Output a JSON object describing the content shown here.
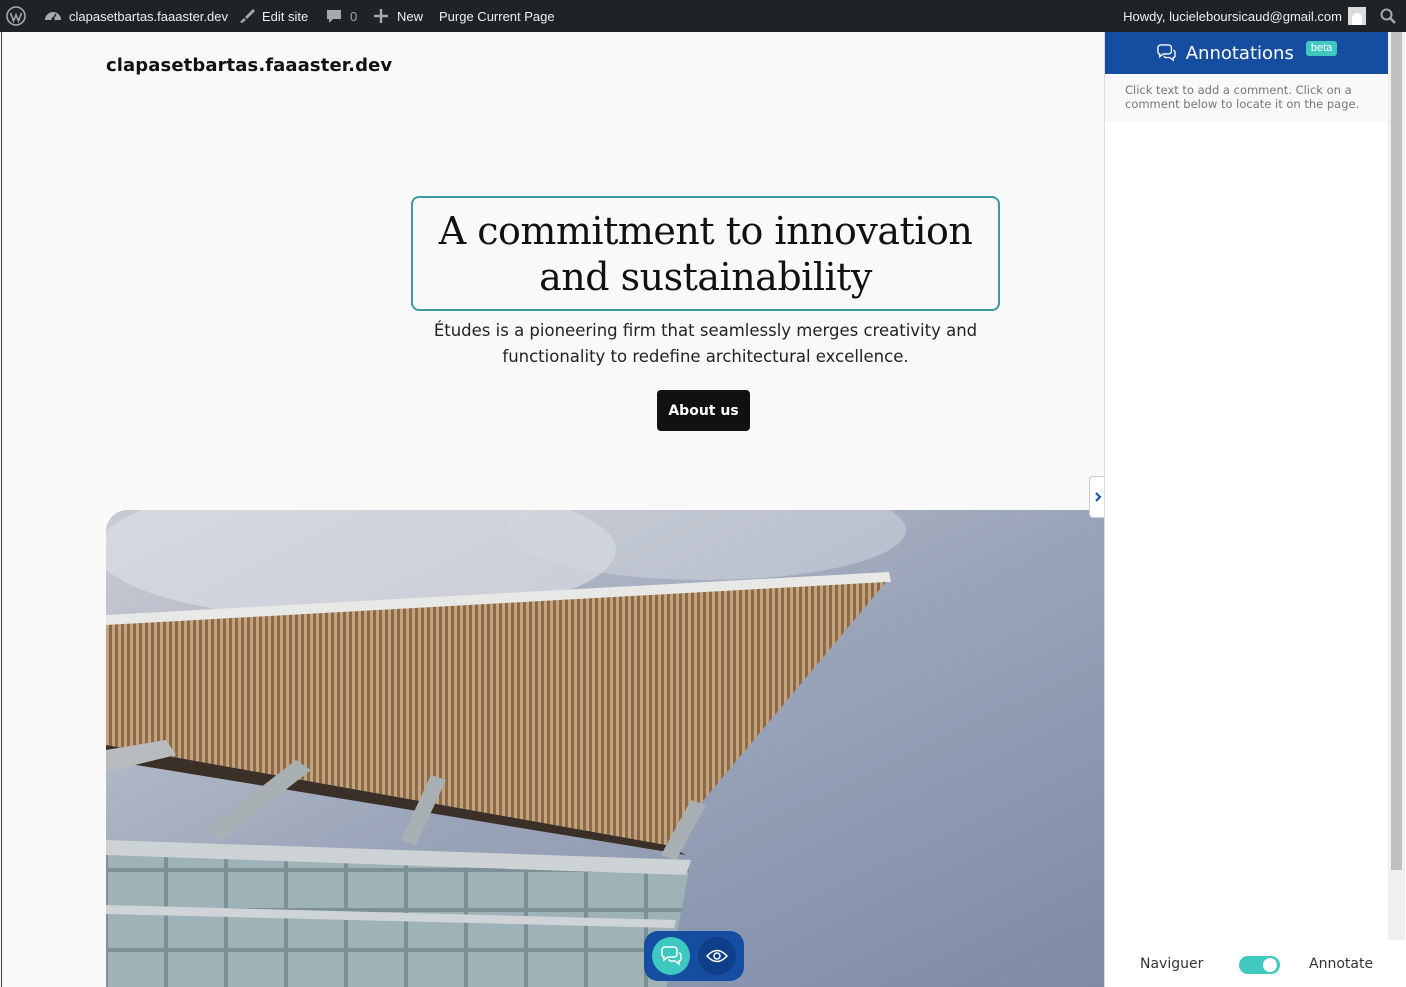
{
  "admin_bar": {
    "site_name": "clapasetbartas.faaaster.dev",
    "edit_site": "Edit site",
    "comments_count": "0",
    "new_label": "New",
    "purge_label": "Purge Current Page",
    "howdy": "Howdy, lucieleboursicaud@gmail.com"
  },
  "site": {
    "title": "clapasetbartas.faaaster.dev",
    "hero_title_line1": "A commitment to innovation",
    "hero_title_line2": "and sustainability",
    "hero_description": "Études is a pioneering firm that seamlessly merges creativity and functionality to redefine architectural excellence.",
    "about_button": "About us"
  },
  "annotations": {
    "title": "Annotations",
    "badge": "beta",
    "help_text": "Click text to add a comment. Click on a comment below to locate it on the page.",
    "mode_left": "Naviguer",
    "mode_right": "Annotate",
    "mode_annotate_on": true
  },
  "colors": {
    "adminbar_bg": "#1d2327",
    "accent_blue": "#154ea0",
    "accent_teal": "#3ec8c0",
    "hero_border": "#3a9c9c"
  }
}
